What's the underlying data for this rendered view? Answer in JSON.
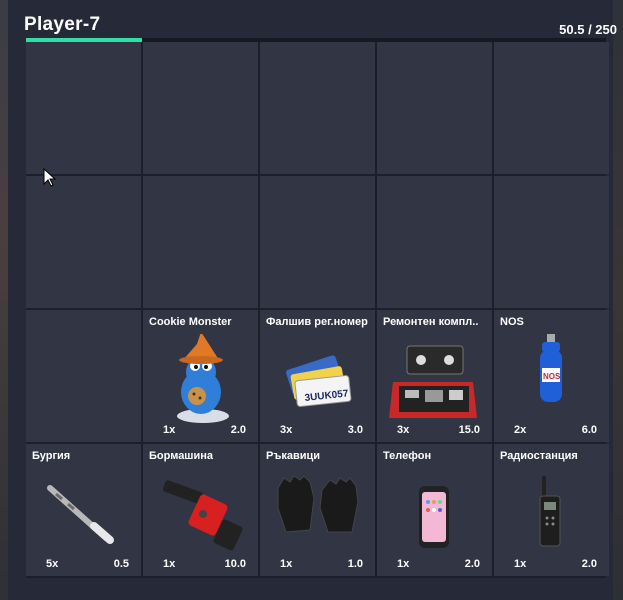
{
  "inventory": {
    "title": "Player-7",
    "weight": "50.5 / 250",
    "weight_fraction": 0.2
  },
  "items": [
    {
      "name": "Cookie Monster",
      "qty": "1x",
      "weight": "2.0",
      "icon": "cookie-monster-figurine-icon"
    },
    {
      "name": "Фалшив рег.номер",
      "qty": "3x",
      "weight": "3.0",
      "icon": "license-plates-icon"
    },
    {
      "name": "Ремонтен компл..",
      "qty": "3x",
      "weight": "15.0",
      "icon": "repair-kit-icon"
    },
    {
      "name": "NOS",
      "qty": "2x",
      "weight": "6.0",
      "icon": "nos-bottle-icon"
    },
    {
      "name": "Бургия",
      "qty": "5x",
      "weight": "0.5",
      "icon": "drill-bit-icon"
    },
    {
      "name": "Бормашина",
      "qty": "1x",
      "weight": "10.0",
      "icon": "power-drill-icon"
    },
    {
      "name": "Ръкавици",
      "qty": "1x",
      "weight": "1.0",
      "icon": "gloves-icon"
    },
    {
      "name": "Телефон",
      "qty": "1x",
      "weight": "2.0",
      "icon": "phone-icon"
    },
    {
      "name": "Радиостанция",
      "qty": "1x",
      "weight": "2.0",
      "icon": "radio-icon"
    }
  ],
  "colors": {
    "accent": "#2fe0a6",
    "panel": "#262937",
    "slot": "#323544"
  }
}
